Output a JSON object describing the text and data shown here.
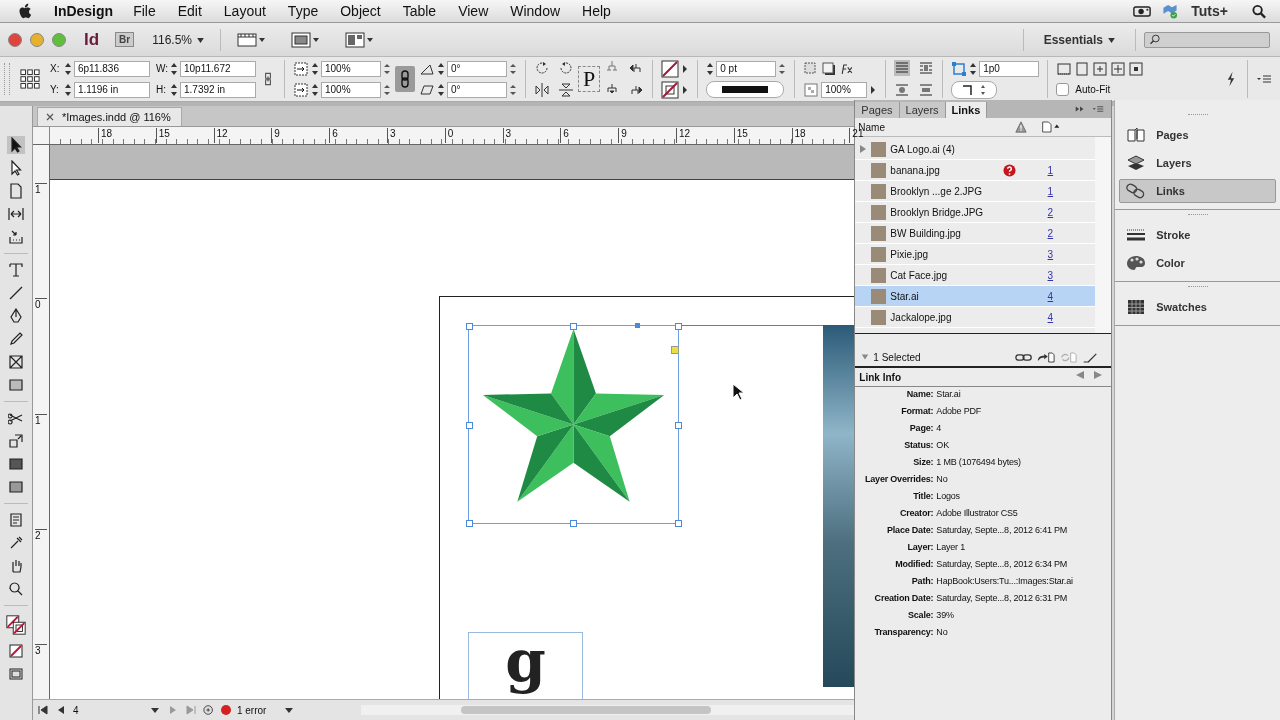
{
  "menubar": {
    "app": "InDesign",
    "menus": [
      "File",
      "Edit",
      "Layout",
      "Type",
      "Object",
      "Table",
      "View",
      "Window",
      "Help"
    ],
    "status_label": "Tuts+"
  },
  "app_bar": {
    "logo": "Id",
    "bridge": "Br",
    "zoom": "116.5%",
    "workspace": "Essentials"
  },
  "control_panel": {
    "position_fields": [
      {
        "label": "X:",
        "value": "6p11.836"
      },
      {
        "label": "Y:",
        "value": "1.1196 in"
      },
      {
        "label": "W:",
        "value": "10p11.672"
      },
      {
        "label": "H:",
        "value": "1.7392 in"
      }
    ],
    "scale_fields": [
      "100%",
      "100%"
    ],
    "angle_fields": [
      "0°",
      "0°"
    ],
    "proxy_glyph": "P",
    "stroke_weight": "0 pt",
    "opacity": "100%",
    "fitting_offset": "1p0",
    "auto_fit": {
      "label": "Auto-Fit",
      "checked": false
    }
  },
  "document": {
    "tab_title": "*Images.indd @ 116%",
    "ruler_horizontal": [
      "18",
      "15",
      "12",
      "9",
      "6",
      "3",
      "0",
      "3",
      "6",
      "9",
      "12",
      "15",
      "18",
      "21"
    ],
    "ruler_vertical": [
      "1",
      "0",
      "1",
      "2",
      "3"
    ],
    "logo_glyph": "g",
    "page_number": "4",
    "preflight": "1 error"
  },
  "links_panel": {
    "tabs": [
      {
        "label": "Pages",
        "selected": false
      },
      {
        "label": "Layers",
        "selected": false
      },
      {
        "label": "Links",
        "selected": true
      }
    ],
    "column_name": "Name",
    "rows": [
      {
        "name": "GA Logo.ai (4)",
        "page": "",
        "expandable": true,
        "missing": false,
        "selected": false
      },
      {
        "name": "banana.jpg",
        "page": "1",
        "expandable": false,
        "missing": true,
        "selected": false
      },
      {
        "name": "Brooklyn ...ge 2.JPG",
        "page": "1",
        "expandable": false,
        "missing": false,
        "selected": false
      },
      {
        "name": "Brooklyn Bridge.JPG",
        "page": "2",
        "expandable": false,
        "missing": false,
        "selected": false
      },
      {
        "name": "BW Building.jpg",
        "page": "2",
        "expandable": false,
        "missing": false,
        "selected": false
      },
      {
        "name": "Pixie.jpg",
        "page": "3",
        "expandable": false,
        "missing": false,
        "selected": false
      },
      {
        "name": "Cat Face.jpg",
        "page": "3",
        "expandable": false,
        "missing": false,
        "selected": false
      },
      {
        "name": "Star.ai",
        "page": "4",
        "expandable": false,
        "missing": false,
        "selected": true
      },
      {
        "name": "Jackalope.jpg",
        "page": "4",
        "expandable": false,
        "missing": false,
        "selected": false
      }
    ],
    "selection_count": "1 Selected",
    "info_title": "Link Info",
    "info": [
      {
        "label": "Name:",
        "value": "Star.ai"
      },
      {
        "label": "Format:",
        "value": "Adobe PDF"
      },
      {
        "label": "Page:",
        "value": "4"
      },
      {
        "label": "Status:",
        "value": "OK"
      },
      {
        "label": "Size:",
        "value": "1 MB (1076494 bytes)"
      },
      {
        "label": "Layer Overrides:",
        "value": "No"
      },
      {
        "label": "Title:",
        "value": "Logos"
      },
      {
        "label": "Creator:",
        "value": "Adobe Illustrator CS5"
      },
      {
        "label": "Place Date:",
        "value": "Saturday, Septe...8, 2012 6:41 PM"
      },
      {
        "label": "Layer:",
        "value": "Layer 1"
      },
      {
        "label": "Modified:",
        "value": "Saturday, Septe...8, 2012 6:34 PM"
      },
      {
        "label": "Path:",
        "value": "HapBook:Users:Tu...:Images:Star.ai"
      },
      {
        "label": "Creation Date:",
        "value": "Saturday, Septe...8, 2012 6:31 PM"
      },
      {
        "label": "Scale:",
        "value": "39%"
      },
      {
        "label": "Transparency:",
        "value": "No"
      }
    ]
  },
  "dock": {
    "groups": [
      {
        "items": [
          {
            "kind": "pages",
            "label": "Pages",
            "selected": false
          },
          {
            "kind": "layers",
            "label": "Layers",
            "selected": false
          },
          {
            "kind": "links",
            "label": "Links",
            "selected": true
          }
        ]
      },
      {
        "items": [
          {
            "kind": "stroke",
            "label": "Stroke",
            "selected": false
          },
          {
            "kind": "color",
            "label": "Color",
            "selected": false
          }
        ]
      },
      {
        "items": [
          {
            "kind": "swatches",
            "label": "Swatches",
            "selected": false
          }
        ]
      }
    ]
  }
}
